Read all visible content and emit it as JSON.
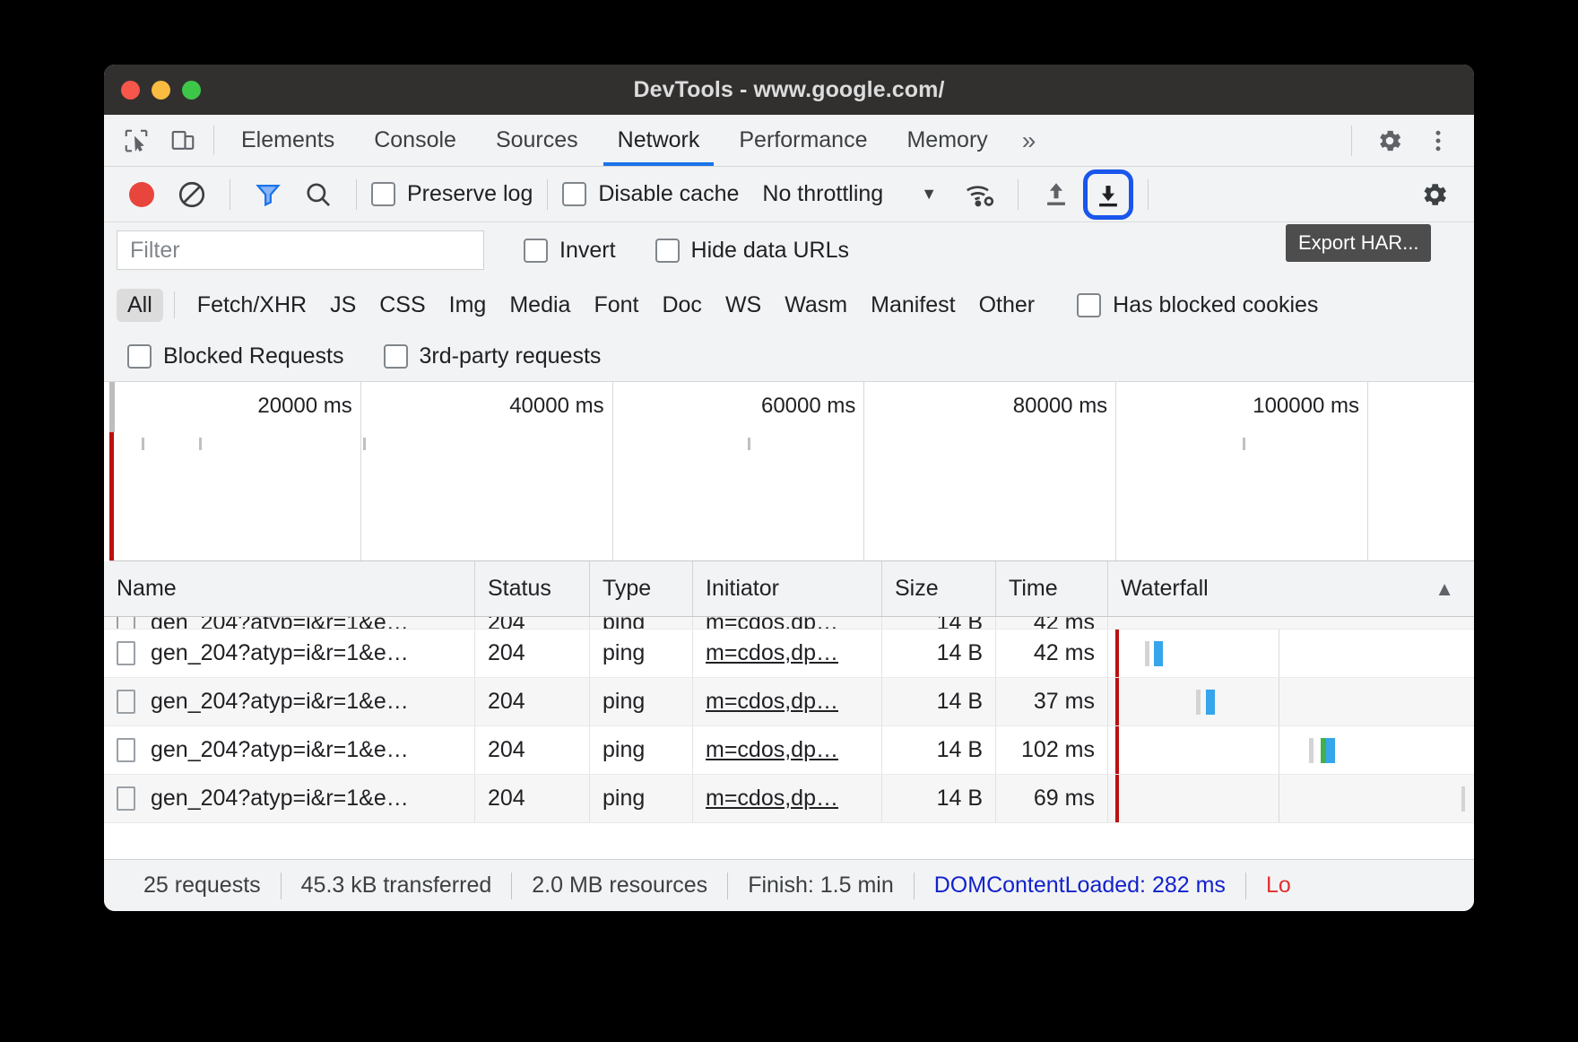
{
  "window": {
    "title": "DevTools - www.google.com/",
    "traffic_lights": [
      "close-red",
      "minimize-yellow",
      "maximize-green"
    ]
  },
  "tabbar": {
    "icons": [
      "inspect-element-icon",
      "device-toolbar-icon"
    ],
    "tabs": [
      {
        "label": "Elements",
        "active": false
      },
      {
        "label": "Console",
        "active": false
      },
      {
        "label": "Sources",
        "active": false
      },
      {
        "label": "Network",
        "active": true
      },
      {
        "label": "Performance",
        "active": false
      },
      {
        "label": "Memory",
        "active": false
      }
    ],
    "more_tabs": "»",
    "right_icons": [
      "gear-icon",
      "more-vertical-icon"
    ]
  },
  "net_toolbar": {
    "record_label": "record-button",
    "clear_label": "clear-button",
    "filter_label": "filter-button",
    "search_label": "search-button",
    "preserve_log": "Preserve log",
    "disable_cache": "Disable cache",
    "throttling_value": "No throttling",
    "caret": "▼",
    "wifi_label": "network-conditions-icon",
    "import_label": "import-har-button",
    "export_label": "export-har-button",
    "settings_label": "network-settings-gear",
    "tooltip": "Export HAR..."
  },
  "filter_row": {
    "filter_placeholder": "Filter",
    "invert": "Invert",
    "hide_data_urls": "Hide data URLs"
  },
  "type_row": {
    "all": "All",
    "types": [
      "Fetch/XHR",
      "JS",
      "CSS",
      "Img",
      "Media",
      "Font",
      "Doc",
      "WS",
      "Wasm",
      "Manifest",
      "Other"
    ],
    "has_blocked_cookies": "Has blocked cookies"
  },
  "flags_row": {
    "blocked_requests": "Blocked Requests",
    "third_party_requests": "3rd-party requests"
  },
  "overview": {
    "ticks": [
      "20000 ms",
      "40000 ms",
      "60000 ms",
      "80000 ms",
      "100000 ms",
      ""
    ]
  },
  "table": {
    "columns": [
      "Name",
      "Status",
      "Type",
      "Initiator",
      "Size",
      "Time",
      "Waterfall"
    ],
    "sort_arrow": "▲",
    "rows": [
      {
        "name": "gen_204?atyp=i&r=1&e…",
        "status": "204",
        "type": "ping",
        "initiator": "m=cdos,dp…",
        "size": "14 B",
        "time": "42 ms"
      },
      {
        "name": "gen_204?atyp=i&r=1&e…",
        "status": "204",
        "type": "ping",
        "initiator": "m=cdos,dp…",
        "size": "14 B",
        "time": "37 ms"
      },
      {
        "name": "gen_204?atyp=i&r=1&e…",
        "status": "204",
        "type": "ping",
        "initiator": "m=cdos,dp…",
        "size": "14 B",
        "time": "102 ms"
      },
      {
        "name": "gen_204?atyp=i&r=1&e…",
        "status": "204",
        "type": "ping",
        "initiator": "m=cdos,dp…",
        "size": "14 B",
        "time": "69 ms"
      }
    ]
  },
  "statusbar": {
    "requests": "25 requests",
    "transferred": "45.3 kB transferred",
    "resources": "2.0 MB resources",
    "finish": "Finish: 1.5 min",
    "dom_content_loaded": "DOMContentLoaded: 282 ms",
    "load": "Lo"
  },
  "colors": {
    "accent_blue": "#1a73e8",
    "focus_ring": "#1a56eb",
    "record_red": "#e8453c",
    "waterfall_blue": "#36a5ec",
    "waterfall_green": "#41b14a",
    "redline": "#bb1111",
    "dcl_blue": "#1122cc",
    "load_red": "#e03030"
  }
}
